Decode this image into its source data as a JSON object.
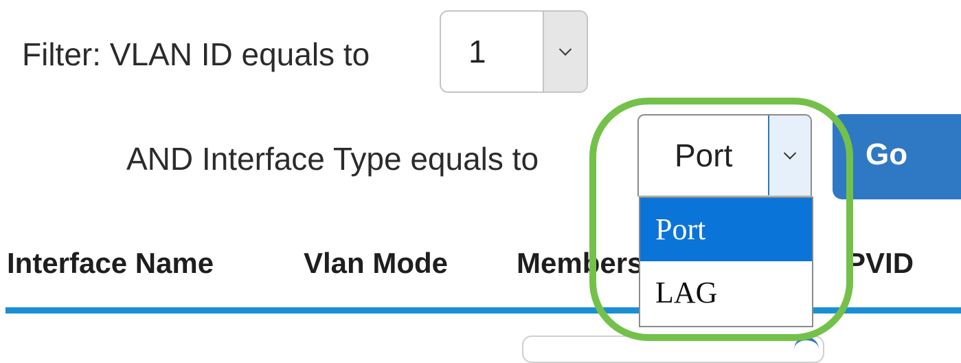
{
  "filter": {
    "vlan_label": "Filter:  VLAN ID equals to",
    "vlan_value": "1",
    "interface_label": "AND Interface Type equals to",
    "interface_value": "Port",
    "go_label": "Go"
  },
  "dropdown": {
    "options": [
      "Port",
      "LAG"
    ],
    "selected": "Port"
  },
  "table": {
    "headers": [
      "Interface Name",
      "Vlan Mode",
      "Membership",
      "PVID"
    ]
  },
  "colors": {
    "accent": "#2f78c4",
    "selected_option": "#0a74d8",
    "highlight": "#74c14a",
    "header_rule": "#1a8fd6"
  },
  "icons": {
    "select_arrow": "chevron-down-icon"
  }
}
